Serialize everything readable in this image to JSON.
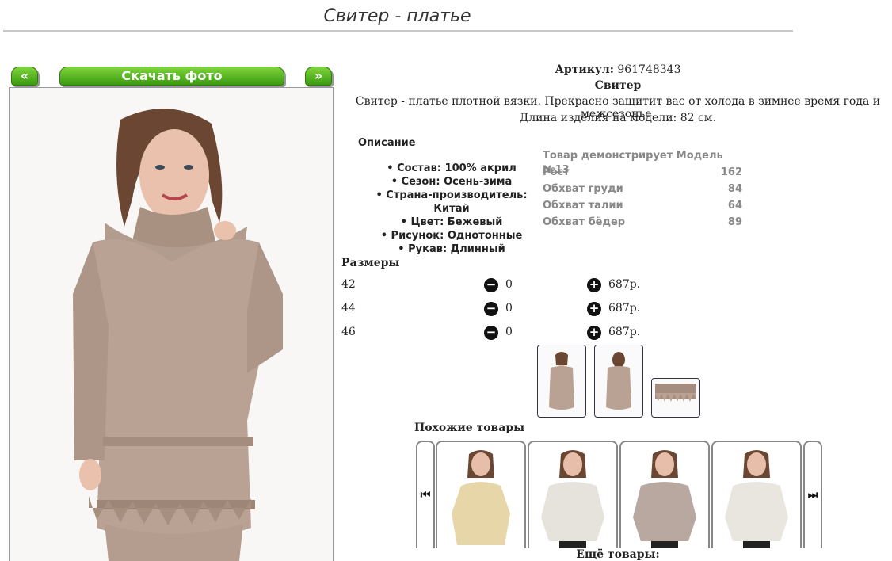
{
  "page": {
    "title": "Свитер - платье"
  },
  "photo_nav": {
    "prev_label": "«",
    "download_label": "Скачать фото",
    "next_label": "»"
  },
  "product": {
    "article_label": "Артикул:",
    "article_value": "961748343",
    "name": "Свитер",
    "description_line1": "Свитер - платье плотной вязки. Прекрасно защитит вас от холода в зимнее время года и межсезонье.",
    "description_line2": "Длина изделия на модели: 82 см."
  },
  "description": {
    "heading": "Описание",
    "items": [
      "• Состав: 100% акрил",
      "• Сезон: Осень-зима",
      "• Страна-производитель: Китай",
      "• Цвет: Бежевый",
      "• Рисунок: Однотонные",
      "• Рукав: Длинный"
    ]
  },
  "model": {
    "heading": "Товар демонстрирует Модель №13",
    "rows": [
      {
        "label": "Рост",
        "value": "162"
      },
      {
        "label": "Обхват груди",
        "value": "84"
      },
      {
        "label": "Обхват талии",
        "value": "64"
      },
      {
        "label": "Обхват бёдер",
        "value": "89"
      }
    ]
  },
  "sizes": {
    "heading": "Размеры",
    "rows": [
      {
        "size": "42",
        "minus": "−",
        "qty": "0",
        "plus": "+",
        "price": "687р."
      },
      {
        "size": "44",
        "minus": "−",
        "qty": "0",
        "plus": "+",
        "price": "687р."
      },
      {
        "size": "46",
        "minus": "−",
        "qty": "0",
        "plus": "+",
        "price": "687р."
      }
    ]
  },
  "similar": {
    "heading": "Похожие товары",
    "prev_icon": "⏮",
    "next_icon": "⏭",
    "more_label": "Ещё товары:"
  },
  "colors": {
    "button_green": "#4cae1a",
    "sweater_beige": "#b9a293"
  }
}
